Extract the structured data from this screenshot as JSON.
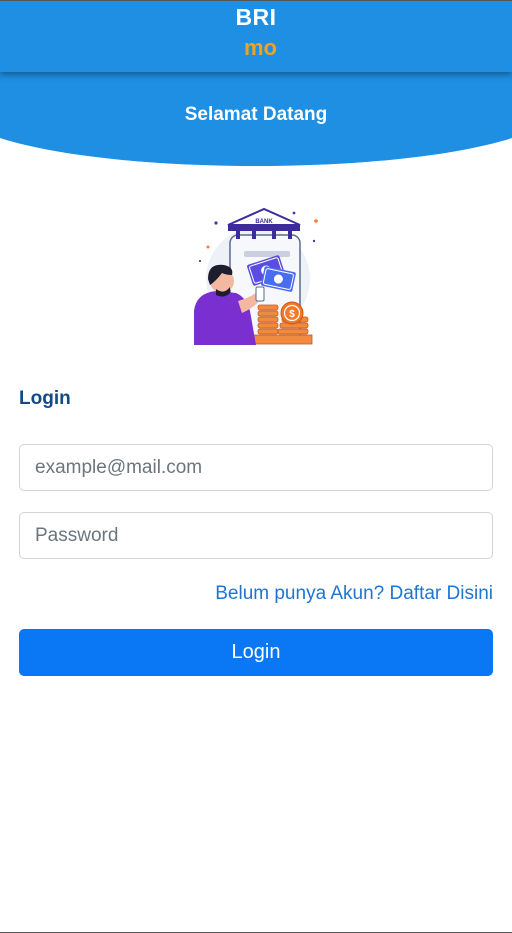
{
  "header": {
    "brand_primary": "BRI",
    "brand_secondary": "mo",
    "welcome": "Selamat Datang",
    "bar_color": "#1e8fe3",
    "accent_color": "#f5a11d"
  },
  "illustration": {
    "icon": "bank-atm-illustration",
    "bank_sign": "BANK"
  },
  "form": {
    "title": "Login",
    "email_placeholder": "example@mail.com",
    "email_value": "",
    "password_placeholder": "Password",
    "password_value": "",
    "register_link": "Belum punya Akun? Daftar Disini",
    "submit_label": "Login",
    "button_color": "#0a78f5"
  }
}
